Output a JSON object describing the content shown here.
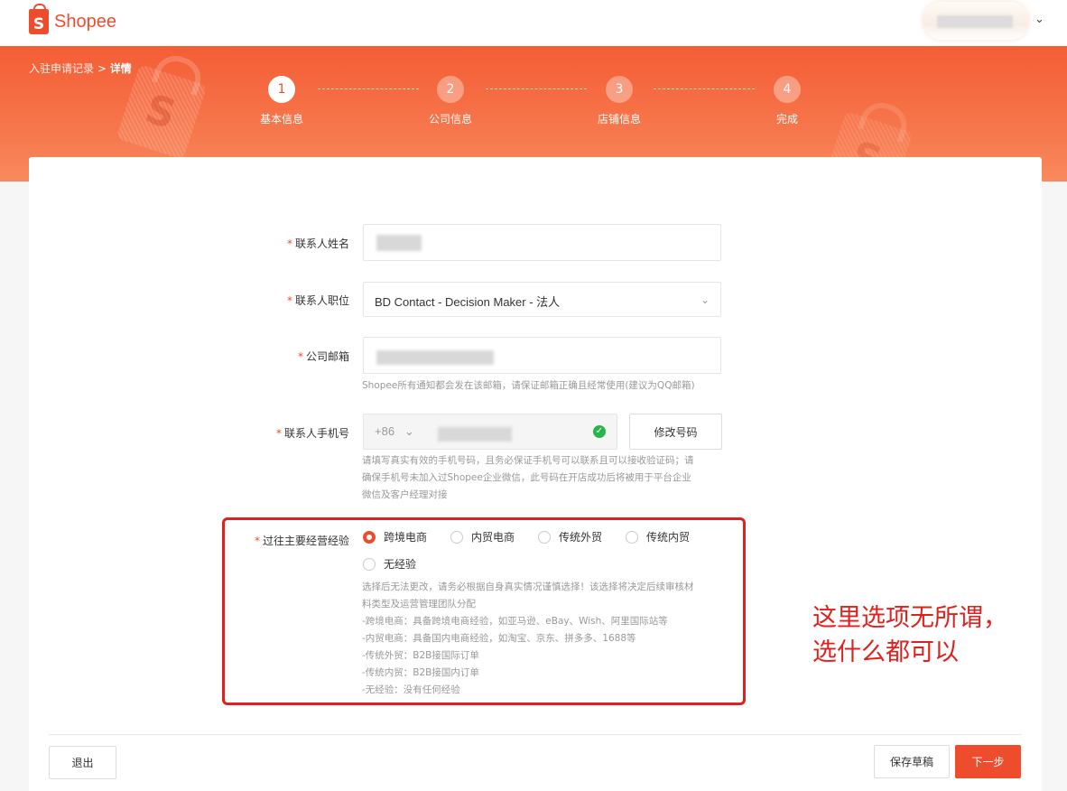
{
  "header": {
    "logo_text": "Shopee",
    "logo_letter": "S"
  },
  "banner": {
    "breadcrumb": {
      "parent": "入驻申请记录",
      "separator": ">",
      "current": "详情"
    },
    "steps": [
      {
        "number": "1",
        "label": "基本信息",
        "status": "active"
      },
      {
        "number": "2",
        "label": "公司信息",
        "status": "pending"
      },
      {
        "number": "3",
        "label": "店铺信息",
        "status": "pending"
      },
      {
        "number": "4",
        "label": "完成",
        "status": "pending"
      }
    ]
  },
  "form": {
    "contact_name": {
      "label": "联系人姓名",
      "required": "*"
    },
    "contact_position": {
      "label": "联系人职位",
      "required": "*",
      "value": "BD Contact - Decision Maker - 法人"
    },
    "company_email": {
      "label": "公司邮箱",
      "required": "*",
      "hint": "Shopee所有通知都会发在该邮箱，请保证邮箱正确且经常使用(建议为QQ邮箱)"
    },
    "phone": {
      "label": "联系人手机号",
      "required": "*",
      "country_code": "+86",
      "change_button": "修改号码",
      "hint_lines": [
        "请填写真实有效的手机号码，且务必保证手机号可以联系且可以接收验证码；请",
        "确保手机号未加入过Shopee企业微信，此号码在开店成功后将被用于平台企业",
        "微信及客户经理对接"
      ]
    },
    "experience": {
      "label": "过往主要经营经验",
      "required": "*",
      "options": [
        {
          "label": "跨境电商",
          "checked": true
        },
        {
          "label": "内贸电商",
          "checked": false
        },
        {
          "label": "传统外贸",
          "checked": false
        },
        {
          "label": "传统内贸",
          "checked": false
        },
        {
          "label": "无经验",
          "checked": false
        }
      ],
      "hint_lines": [
        "选择后无法更改，请务必根据自身真实情况谨慎选择！该选择将决定后续审核材",
        "料类型及运营管理团队分配",
        "-跨境电商：具备跨境电商经验，如亚马逊、eBay、Wish、阿里国际站等",
        "-内贸电商：具备国内电商经验，如淘宝、京东、拼多多、1688等",
        "-传统外贸：B2B接国际订单",
        "-传统内贸：B2B接国内订单",
        "-无经验：没有任何经验"
      ]
    }
  },
  "annotation": {
    "lines": [
      "这里选项无所谓，",
      "选什么都可以"
    ],
    "color": "#e0201c"
  },
  "footer": {
    "exit_button": "退出",
    "save_draft_button": "保存草稿",
    "next_button": "下一步"
  },
  "colors": {
    "brand": "#ee4d2d",
    "success": "#2ab44c"
  }
}
